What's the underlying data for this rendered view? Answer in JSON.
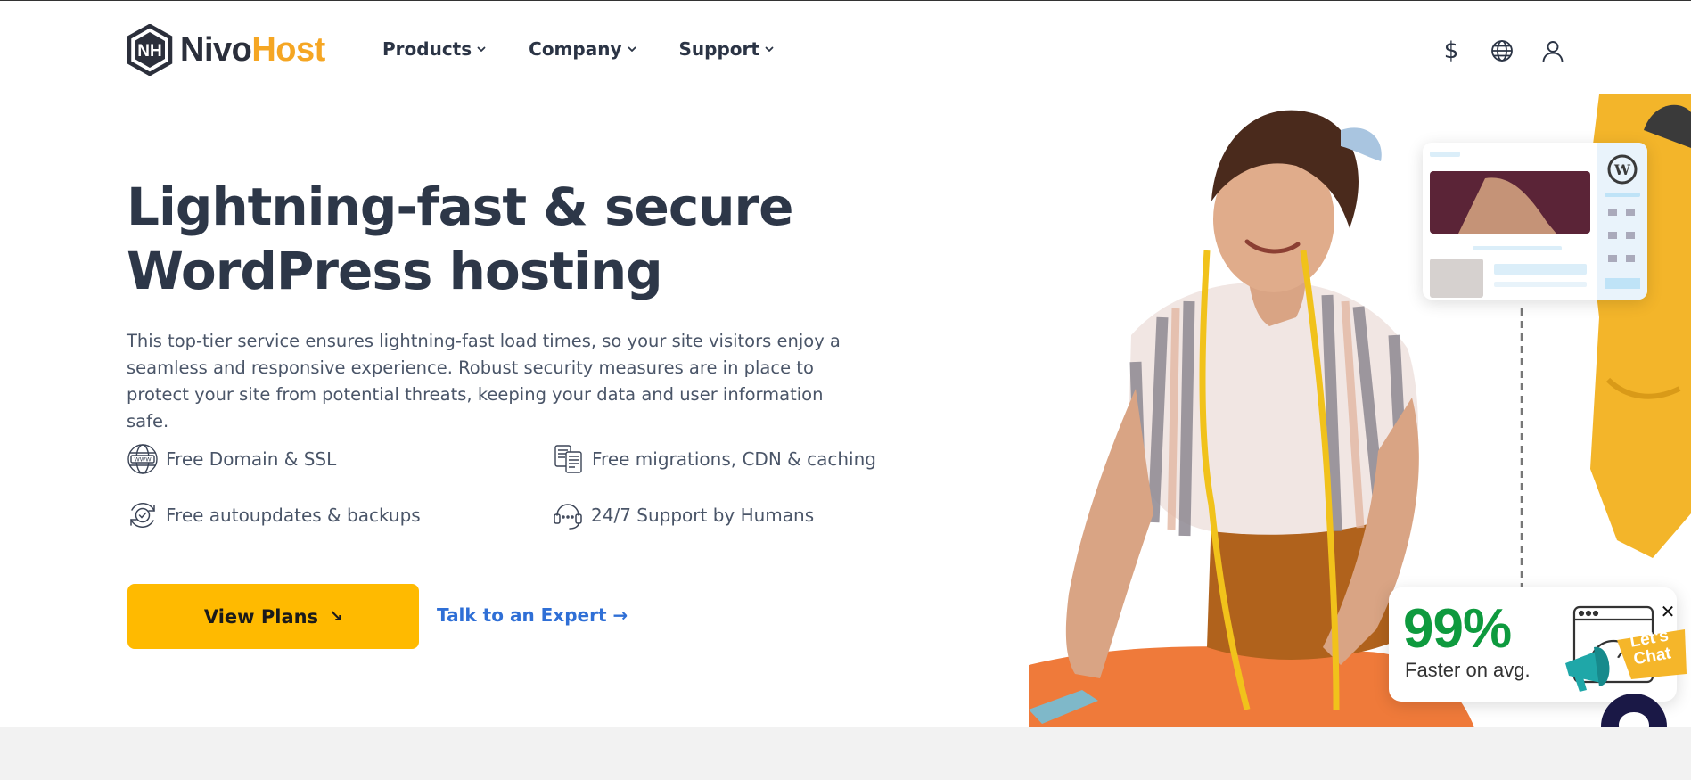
{
  "brand": {
    "name_part1": "Nivo",
    "name_part2": "Host",
    "mark_letters": "NH",
    "primary_color": "#2b2f3b",
    "accent_color": "#f5a623"
  },
  "nav": {
    "items": [
      {
        "label": "Products",
        "icon": "chevron-down-icon"
      },
      {
        "label": "Company",
        "icon": "chevron-down-icon"
      },
      {
        "label": "Support",
        "icon": "chevron-down-icon"
      }
    ]
  },
  "utility": {
    "currency_symbol": "$",
    "icons": [
      "dollar-icon",
      "globe-icon",
      "user-icon"
    ]
  },
  "hero": {
    "title_line1": "Lightning-fast & secure",
    "title_line2": "WordPress hosting",
    "description": "This top-tier service ensures lightning-fast load times, so your site visitors enjoy a seamless and responsive experience. Robust security measures are in place to protect your site from potential threats, keeping your data and user information safe.",
    "features": [
      {
        "label": "Free Domain & SSL",
        "icon": "www-globe-icon"
      },
      {
        "label": "Free migrations, CDN & caching",
        "icon": "documents-icon"
      },
      {
        "label": "Free autoupdates & backups",
        "icon": "refresh-check-icon"
      },
      {
        "label": "24/7 Support by Humans",
        "icon": "headset-icon"
      }
    ],
    "primary_cta": "View Plans",
    "primary_cta_arrow": "↘",
    "secondary_cta": "Talk to an Expert →",
    "cta_color": "#ffba00",
    "link_color": "#2f6fd6"
  },
  "stats_card": {
    "value": "99%",
    "label": "Faster on avg.",
    "close_glyph": "✕",
    "value_color": "#0e9a3e"
  },
  "chat": {
    "badge_text": "Let's Chat",
    "bubble_color": "#1a1846"
  }
}
